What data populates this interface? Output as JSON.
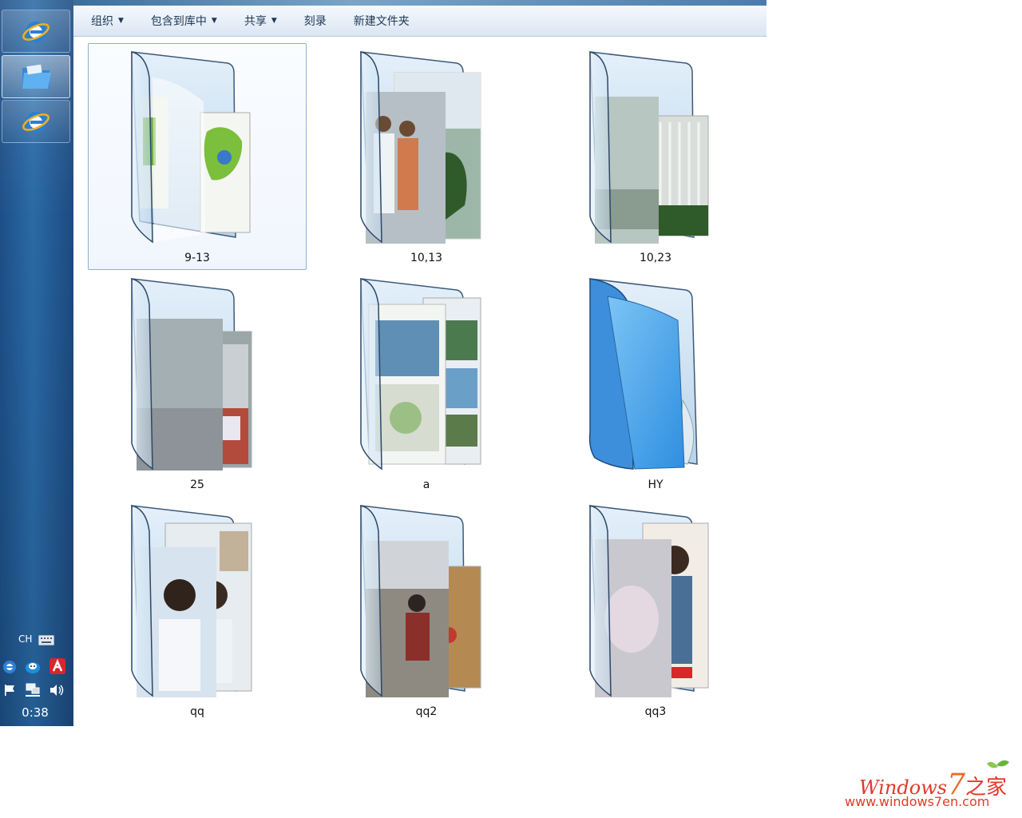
{
  "toolbar": {
    "items": [
      {
        "label": "组织",
        "dropdown": true
      },
      {
        "label": "包含到库中",
        "dropdown": true
      },
      {
        "label": "共享",
        "dropdown": true
      },
      {
        "label": "刻录",
        "dropdown": false
      },
      {
        "label": "新建文件夹",
        "dropdown": false
      }
    ]
  },
  "folders": [
    {
      "name": "9-13",
      "selected": true,
      "preview": "site-plan"
    },
    {
      "name": "10,13",
      "selected": false,
      "preview": "people-photo"
    },
    {
      "name": "10,23",
      "selected": false,
      "preview": "building-photo"
    },
    {
      "name": "25",
      "selected": false,
      "preview": "street-photo"
    },
    {
      "name": "a",
      "selected": false,
      "preview": "landscape-board"
    },
    {
      "name": "HY",
      "selected": false,
      "preview": "empty-blue"
    },
    {
      "name": "qq",
      "selected": false,
      "preview": "webcam-portrait"
    },
    {
      "name": "qq2",
      "selected": false,
      "preview": "group-photo"
    },
    {
      "name": "qq3",
      "selected": false,
      "preview": "portrait-magazine"
    }
  ],
  "taskbar": {
    "pinned": [
      {
        "icon": "internet-explorer-icon"
      },
      {
        "icon": "windows-explorer-icon",
        "active": true
      },
      {
        "icon": "internet-explorer-icon"
      }
    ],
    "language": "CH",
    "clock": "0:38"
  },
  "watermark": {
    "brand_prefix": "Windows",
    "brand_num": "7",
    "brand_suffix": "之家",
    "url": "www.windows7en.com"
  },
  "colors": {
    "taskbar": "#2a6aa6",
    "selection_border": "#8fb1d6",
    "watermark_red": "#e03a2a",
    "watermark_blue": "#3068b5"
  }
}
